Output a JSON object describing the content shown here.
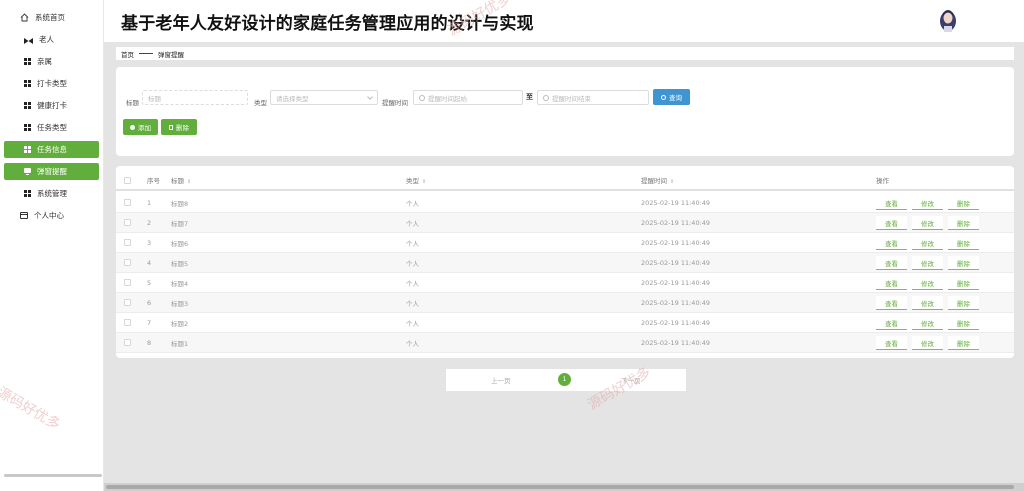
{
  "app": {
    "title": "基于老年人友好设计的家庭任务管理应用的设计与实现",
    "watermark": "源码好优多"
  },
  "sidebar": {
    "items": [
      {
        "label": "系统首页",
        "icon": "home-icon",
        "active": false
      },
      {
        "label": "老人",
        "icon": "bow-icon",
        "active": false
      },
      {
        "label": "亲属",
        "icon": "grid-icon",
        "active": false
      },
      {
        "label": "打卡类型",
        "icon": "grid-icon",
        "active": false
      },
      {
        "label": "健康打卡",
        "icon": "grid-icon",
        "active": false
      },
      {
        "label": "任务类型",
        "icon": "grid-icon",
        "active": false
      },
      {
        "label": "任务信息",
        "icon": "grid-icon",
        "active": true
      },
      {
        "label": "弹窗提醒",
        "icon": "monitor-icon",
        "active": true
      },
      {
        "label": "系统管理",
        "icon": "grid-icon",
        "active": false
      },
      {
        "label": "个人中心",
        "icon": "card-icon",
        "active": false
      }
    ]
  },
  "breadcrumb": {
    "home": "首页",
    "current": "弹窗提醒"
  },
  "filters": {
    "title_label": "标题",
    "title_placeholder": "标题",
    "type_label": "类型",
    "type_placeholder": "请选择类型",
    "time_label": "提醒时间",
    "time_start_placeholder": "提醒时间起始",
    "time_to": "至",
    "time_end_placeholder": "提醒时间结束",
    "query_button": "查询",
    "add_button": "添加",
    "delete_button": "删除"
  },
  "table": {
    "headers": {
      "index": "序号",
      "title": "标题",
      "type": "类型",
      "time": "提醒时间",
      "actions": "操作"
    },
    "sort_glyph": "⇕",
    "action_labels": {
      "view": "查看",
      "edit": "修改",
      "delete": "删除"
    },
    "rows": [
      {
        "index": "1",
        "title": "标题8",
        "type": "个人",
        "time": "2025-02-19 11:40:49"
      },
      {
        "index": "2",
        "title": "标题7",
        "type": "个人",
        "time": "2025-02-19 11:40:49"
      },
      {
        "index": "3",
        "title": "标题6",
        "type": "个人",
        "time": "2025-02-19 11:40:49"
      },
      {
        "index": "4",
        "title": "标题5",
        "type": "个人",
        "time": "2025-02-19 11:40:49"
      },
      {
        "index": "5",
        "title": "标题4",
        "type": "个人",
        "time": "2025-02-19 11:40:49"
      },
      {
        "index": "6",
        "title": "标题3",
        "type": "个人",
        "time": "2025-02-19 11:40:49"
      },
      {
        "index": "7",
        "title": "标题2",
        "type": "个人",
        "time": "2025-02-19 11:40:49"
      },
      {
        "index": "8",
        "title": "标题1",
        "type": "个人",
        "time": "2025-02-19 11:40:49"
      }
    ]
  },
  "pagination": {
    "prev": "上一页",
    "current": "1",
    "next": "下一页"
  },
  "colors": {
    "accent": "#62ae3d",
    "query": "#3e95d1",
    "background": "#e4e4e4"
  }
}
